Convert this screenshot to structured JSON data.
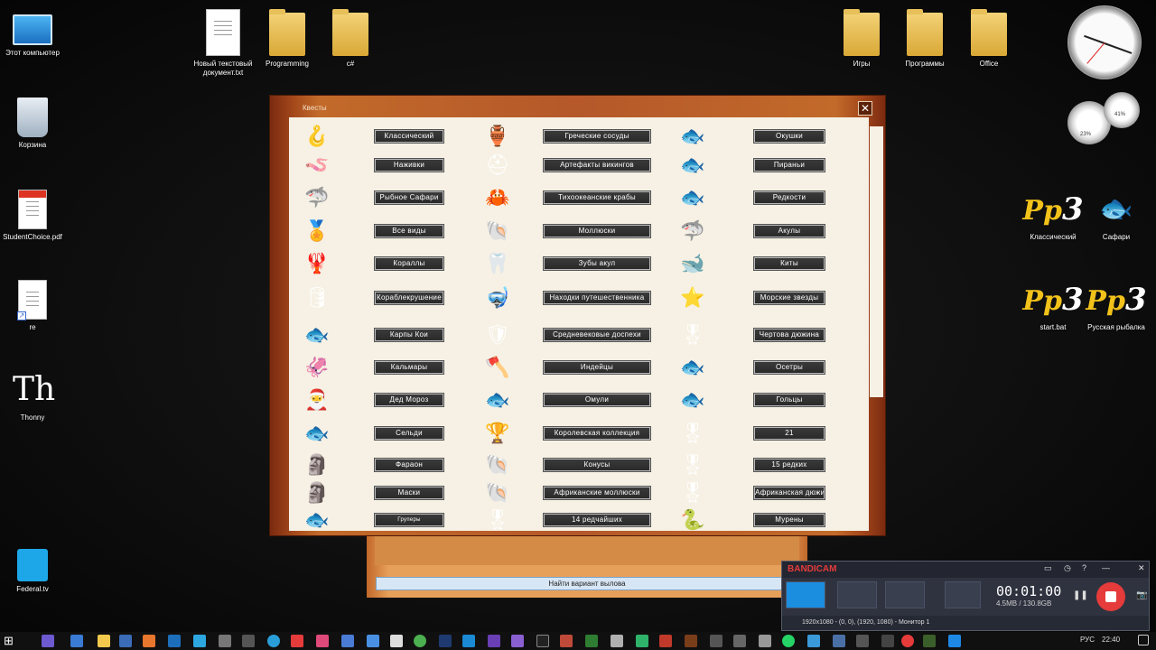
{
  "desktop": {
    "left_icons": [
      {
        "label": "Этот компьютер",
        "icon": "computer-icon"
      },
      {
        "label": "Корзина",
        "icon": "recycle-bin-icon"
      },
      {
        "label": "StudentChoice.pdf",
        "icon": "pdf-icon"
      },
      {
        "label": "re",
        "icon": "djvu-icon"
      },
      {
        "label": "Thonny",
        "icon": "thonny-icon"
      },
      {
        "label": "Federal.tv",
        "icon": "tv-icon"
      }
    ],
    "top_icons": [
      {
        "label": "Новый текстовый документ.txt",
        "icon": "text-file-icon"
      },
      {
        "label": "Programming",
        "icon": "folder-icon"
      },
      {
        "label": "c#",
        "icon": "folder-icon"
      },
      {
        "label": "Игры",
        "icon": "folder-icon"
      },
      {
        "label": "Программы",
        "icon": "folder-icon"
      },
      {
        "label": "Office",
        "icon": "folder-icon"
      }
    ],
    "right_icons": [
      {
        "label": "Классический",
        "icon": "rr3-icon"
      },
      {
        "label": "Сафари",
        "icon": "fish-icon"
      },
      {
        "label": "start.bat",
        "icon": "rr3-icon"
      },
      {
        "label": "Русская рыбалка",
        "icon": "rr3-icon"
      }
    ],
    "gauge_labels": [
      "23%",
      "41%"
    ]
  },
  "quest_window": {
    "title": "Квесты",
    "close": "✕",
    "col1": [
      "Классический",
      "Наживки",
      "Рыбное Сафари",
      "Все виды",
      "Кораллы",
      "Кораблекрушение",
      "Карпы Кои",
      "Кальмары",
      "Дед Мороз",
      "Сельди",
      "Фараон",
      "Маски",
      "Груперы"
    ],
    "col2": [
      "Греческие сосуды",
      "Артефакты викингов",
      "Тихоокеанские крабы",
      "Моллюски",
      "Зубы акул",
      "Находки путешественника",
      "Средневековые доспехи",
      "Индейцы",
      "Омули",
      "Королевская коллекция",
      "Конусы",
      "Африканские моллюски",
      "14 редчайших"
    ],
    "col3": [
      "Окушки",
      "Пираньи",
      "Редкости",
      "Акулы",
      "Киты",
      "Морские звезды",
      "Чертова дюжина",
      "Осетры",
      "Гольцы",
      "21",
      "15 редких",
      "Африканская дюжина",
      "Мурены"
    ],
    "icons1": [
      "🪝",
      "🪱",
      "🦈",
      "🏅",
      "🦞",
      "🛢",
      "🐟",
      "🦑",
      "🎅",
      "🐟",
      "🗿",
      "🗿",
      "🐟"
    ],
    "icons2": [
      "🏺",
      "⛑",
      "🦀",
      "🐚",
      "🦷",
      "🤿",
      "🛡",
      "🪓",
      "🐟",
      "🏆",
      "🐚",
      "🐚",
      "🎖"
    ],
    "icons3": [
      "🐟",
      "🐟",
      "🐟",
      "🦈",
      "🐋",
      "⭐",
      "🎖",
      "🐟",
      "🐟",
      "🎖",
      "🎖",
      "🎖",
      "🐍"
    ]
  },
  "lower_panel": {
    "button": "Найти вариант вылова"
  },
  "bandicam": {
    "logo_a": "BANDI",
    "logo_b": "CAM",
    "timer": "00:01:00",
    "size": "4.5MB / 130.8GB",
    "status": "1920x1080 - (0, 0), (1920, 1080) - Монитор 1",
    "pause": "❚❚",
    "camera": "📷",
    "win_buttons": [
      "▭",
      "◷",
      "?",
      "—",
      "✕"
    ]
  },
  "taskbar": {
    "start": "⊞",
    "lang": "РУС",
    "time": "22:40"
  }
}
